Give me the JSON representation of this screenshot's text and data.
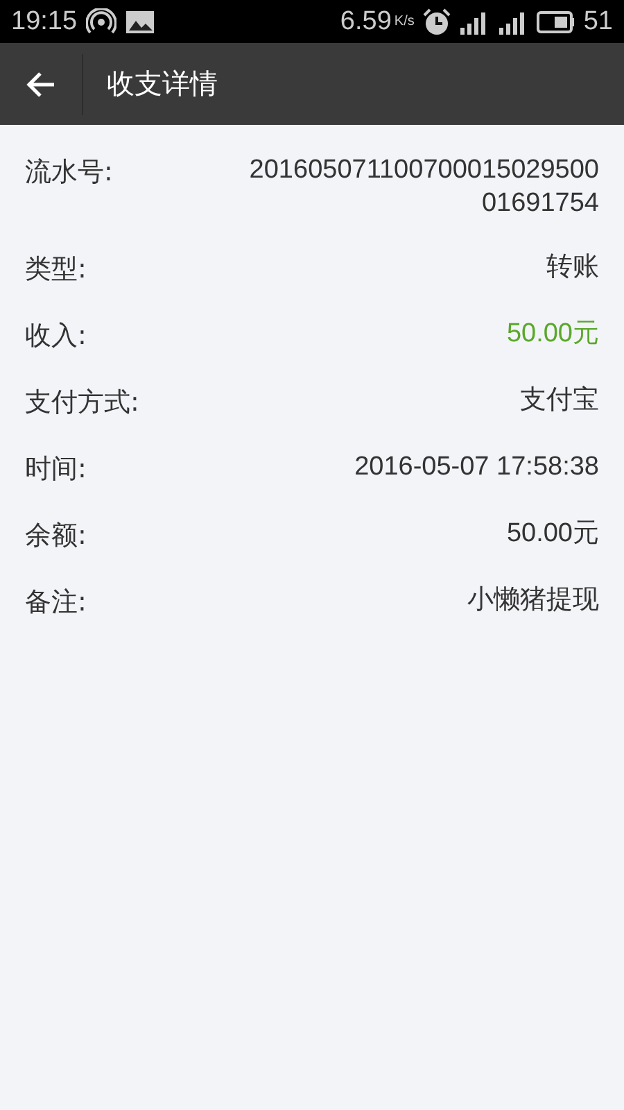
{
  "status_bar": {
    "time": "19:15",
    "speed": "6.59",
    "speed_unit": "K/s",
    "battery": "51"
  },
  "app_bar": {
    "title": "收支详情"
  },
  "details": [
    {
      "label": "流水号:",
      "value": "20160507110070001502950001691754",
      "kind": "plain"
    },
    {
      "label": "类型:",
      "value": "转账",
      "kind": "plain"
    },
    {
      "label": "收入:",
      "value": "50.00元",
      "kind": "income"
    },
    {
      "label": "支付方式:",
      "value": "支付宝",
      "kind": "plain"
    },
    {
      "label": "时间:",
      "value": "2016-05-07 17:58:38",
      "kind": "plain"
    },
    {
      "label": "余额:",
      "value": "50.00元",
      "kind": "plain"
    },
    {
      "label": "备注:",
      "value": "小懒猪提现",
      "kind": "plain"
    }
  ]
}
